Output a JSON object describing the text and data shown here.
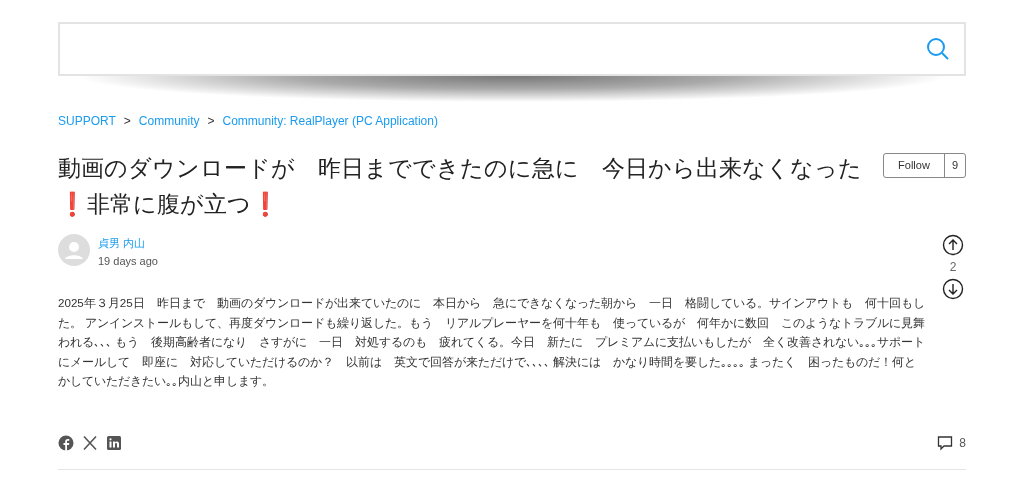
{
  "breadcrumb": {
    "separator": ">",
    "items": [
      "SUPPORT",
      "Community",
      "Community: RealPlayer (PC Application)"
    ]
  },
  "post": {
    "title": "動画のダウンロードが　昨日までできたのに急に　今日から出来なくなった　❗非常に腹が立つ❗",
    "follow": {
      "label": "Follow",
      "count": "9"
    },
    "author": "貞男 内山",
    "time": "19 days ago",
    "votes": "2",
    "body": "2025年３月25日　昨日まで　動画のダウンロードが出来ていたのに　本日から　急にできなくなった朝から　一日　格闘している。サインアウトも　何十回もした。 アンインストールもして、再度ダウンロードも繰り返した。もう　リアルプレーヤーを何十年も　使っているが　何年かに数回　このようなトラブルに見舞われる､､､ もう　後期高齢者になり　さすがに　一日　対処するのも　疲れてくる。今日　新たに　プレミアムに支払いもしたが　全く改善されない｡｡｡サポートにメールして　即座に　対応していただけるのか？　以前は　英文で回答が来ただけで､､､､ 解決には　かなり時間を要した｡｡｡｡ まったく　困ったものだ！何とかしていただきたい｡｡内山と申します。",
    "comments": "8"
  }
}
